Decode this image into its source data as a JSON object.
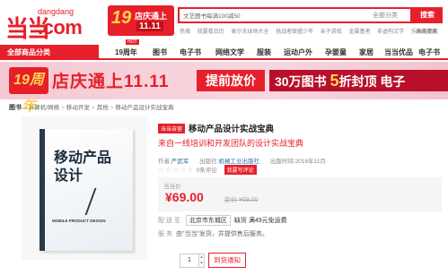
{
  "header": {
    "logo_mark": "当当",
    "logo_url": "dangdang",
    "logo_com": ".com",
    "promo": {
      "num": "19",
      "line1": "店庆通上",
      "line2": "11.11"
    },
    "search": {
      "value": "文艺图书每满100减50",
      "category": "全部分类",
      "button": "搜索"
    },
    "hotwords": [
      "热搜",
      "我要看日历",
      "高尔夫球场大全",
      "挑战者联盟少年",
      "亲子游戏",
      "金属基者",
      "非虚构文学",
      "乐天与杰克"
    ],
    "advanced": "高级搜索"
  },
  "nav": {
    "all_categories": "全部商品分类",
    "hot_tag": "HOT",
    "items": [
      "19周年",
      "图书",
      "电子书",
      "网络文学",
      "服装",
      "运动户外",
      "孕婴童",
      "家居",
      "当当优品",
      "电子书"
    ]
  },
  "banner": {
    "badge": "19周年",
    "main": "店庆通上11.11",
    "tiqian": "提前放价",
    "offer_prefix": "30万图书 ",
    "offer_num": "5",
    "offer_suffix": "折封顶  电子"
  },
  "breadcrumbs": [
    "图书",
    "计算机/网络",
    "移动开发",
    "其他",
    "移动产品设计实战宝典"
  ],
  "book": {
    "cover_title_1": "移动产品",
    "cover_title_2": "设计",
    "cover_en": "MOBILE PRODUCT DESIGN"
  },
  "product": {
    "self_badge": "当当自营",
    "title": "移动产品设计实战宝典",
    "subtitle": "来自一线培训和开发团队的设计实战宝典",
    "author_label": "作者:",
    "author": "严武军",
    "publisher_label": "出版社:",
    "publisher": "机械工业出版社",
    "date_label": "出版时间:",
    "date": "2018年11月",
    "stars": "☆☆☆☆☆",
    "reviews": "0条评论",
    "review_btn": "我要写评论",
    "price_label": "当当价",
    "price": "¥69.00",
    "old_price": "定价 ¥69.00",
    "ship_label": "配 送 至",
    "ship_location": "北京市东城区",
    "stock": "缺货 满49元免运费",
    "service_label": "服    务",
    "service": "由\"当当\"发货，并提供售后服务。",
    "qty": "1",
    "notify_btn": "到货通知"
  },
  "colors": {
    "brand": "#e6202b",
    "link": "#2b6bb5"
  }
}
